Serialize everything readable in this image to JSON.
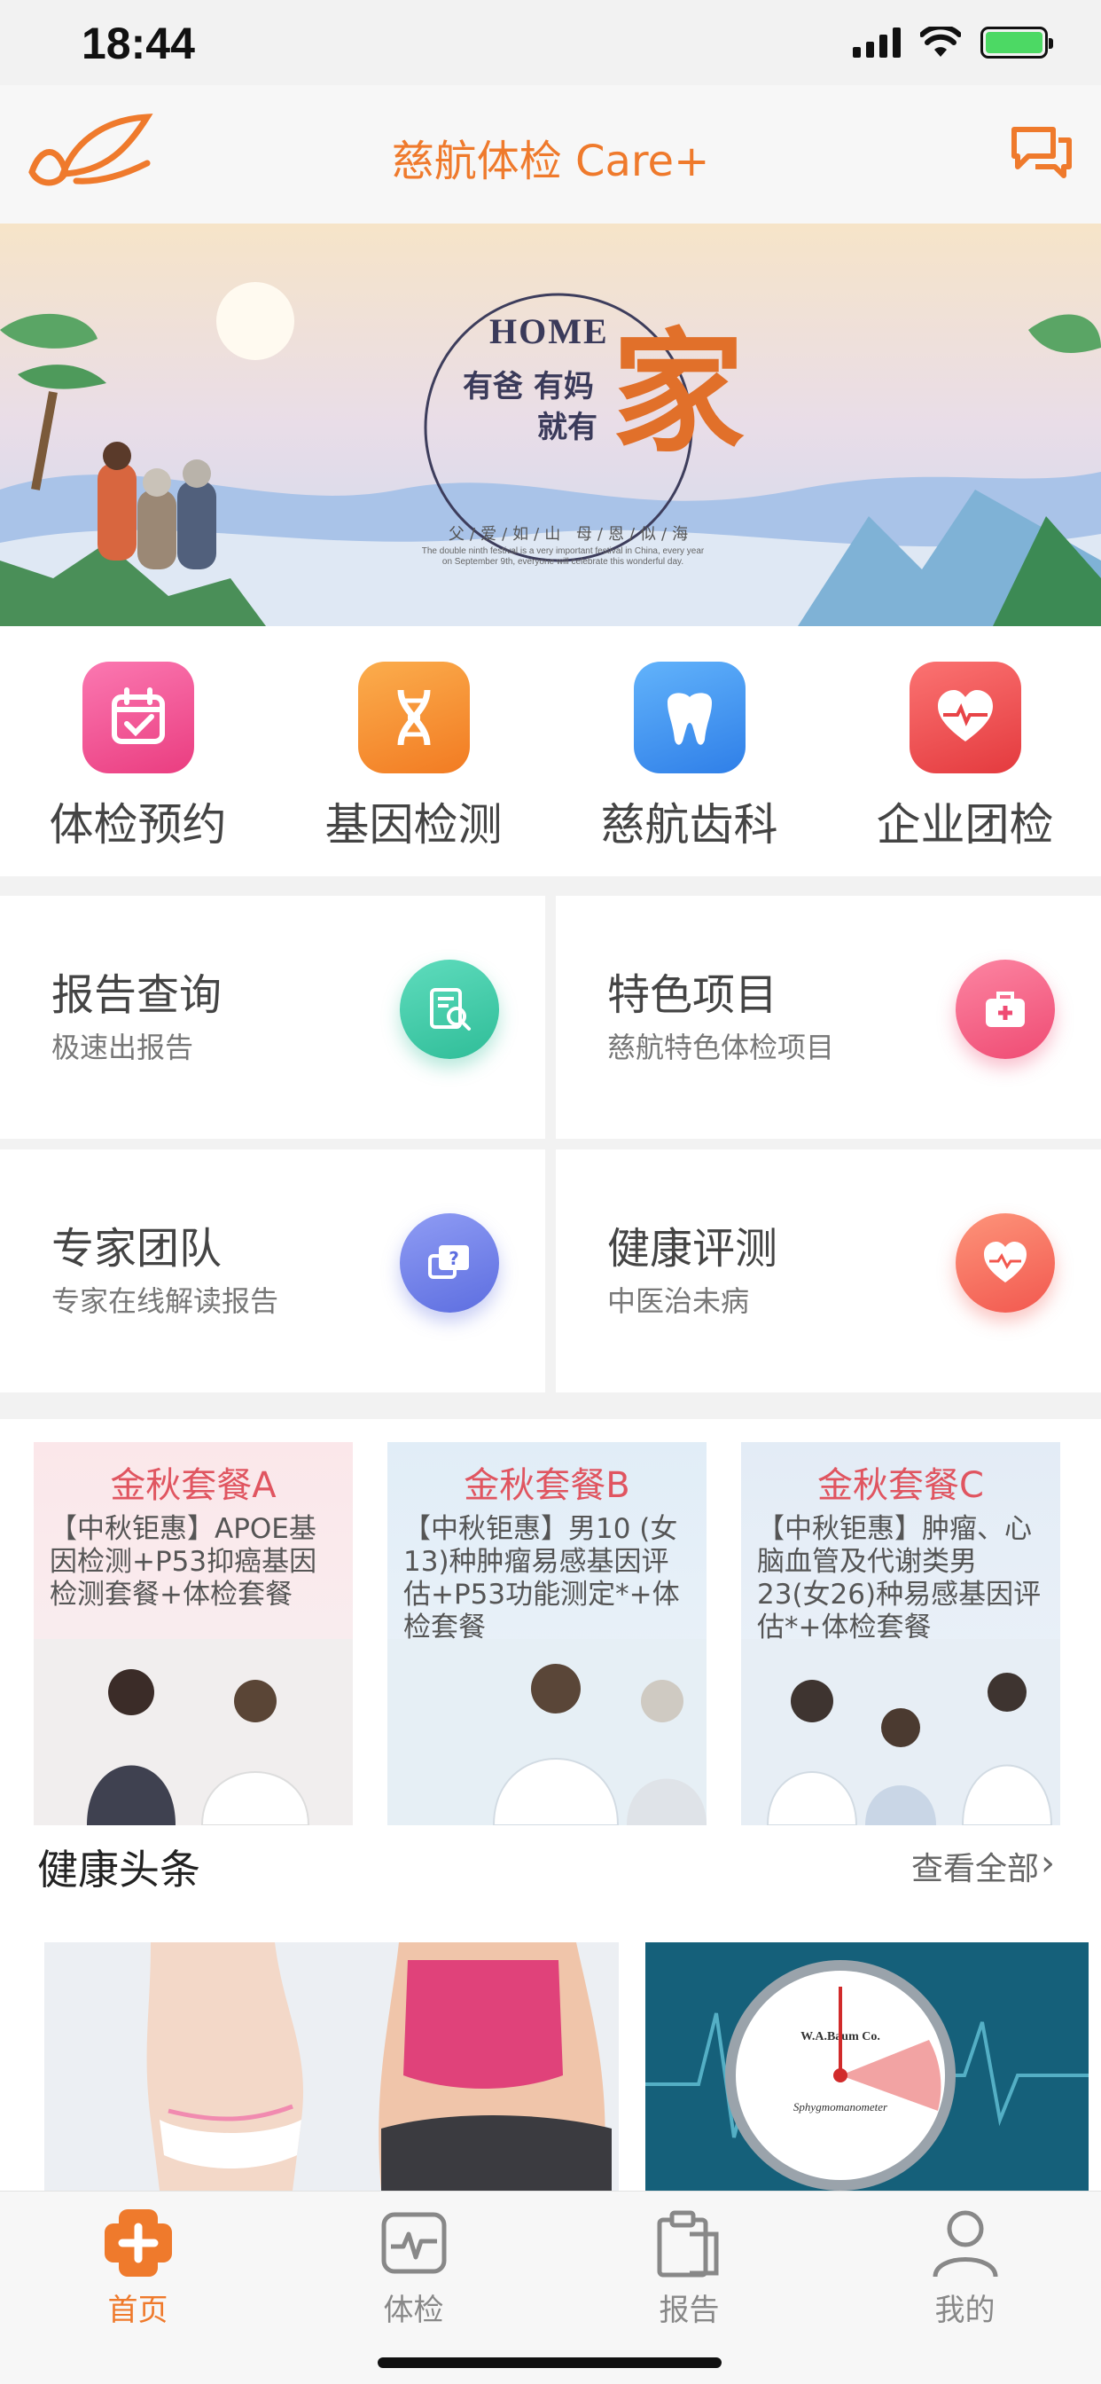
{
  "status_bar": {
    "time": "18:44"
  },
  "nav": {
    "title": "慈航体检 Care+"
  },
  "banner": {
    "home_text": "HOME",
    "line1": "有爸 有妈",
    "line2": "就有",
    "big_char": "家",
    "motto": "父/爱/如/山  母/恩/似/海",
    "desc": "The double ninth festival is a very important festival in China, every year on September 9th, everyone will celebrate this wonderful day."
  },
  "quick_menu": [
    {
      "label": "体检预约",
      "icon": "calendar-icon",
      "color": "#f0508a"
    },
    {
      "label": "基因检测",
      "icon": "dna-icon",
      "color": "#f3892e"
    },
    {
      "label": "慈航齿科",
      "icon": "tooth-icon",
      "color": "#3f95f0"
    },
    {
      "label": "企业团检",
      "icon": "heart-pulse-icon",
      "color": "#ee4a48"
    }
  ],
  "services": [
    {
      "title": "报告查询",
      "subtitle": "极速出报告",
      "icon": "report-search-icon",
      "color": "#37c7a6"
    },
    {
      "title": "特色项目",
      "subtitle": "慈航特色体检项目",
      "icon": "medical-kit-icon",
      "color": "#f2567d"
    },
    {
      "title": "专家团队",
      "subtitle": "专家在线解读报告",
      "icon": "question-chat-icon",
      "color": "#6c7de8"
    },
    {
      "title": "健康评测",
      "subtitle": "中医治未病",
      "icon": "heart-check-icon",
      "color": "#f66b5a"
    }
  ],
  "packages": [
    {
      "title": "金秋套餐A",
      "desc": "【中秋钜惠】APOE基因检测+P53抑癌基因检测套餐+体检套餐"
    },
    {
      "title": "金秋套餐B",
      "desc": "【中秋钜惠】男10 (女13)种肿瘤易感基因评估+P53功能测定*+体检套餐"
    },
    {
      "title": "金秋套餐C",
      "desc": "【中秋钜惠】肿瘤、心脑血管及代谢类男23(女26)种易感基因评估*+体检套餐"
    }
  ],
  "news": {
    "title": "健康头条",
    "view_all": "查看全部"
  },
  "tab_bar": [
    {
      "label": "首页",
      "icon": "home-cross-icon",
      "active": true
    },
    {
      "label": "体检",
      "icon": "pulse-monitor-icon",
      "active": false
    },
    {
      "label": "报告",
      "icon": "clipboard-icon",
      "active": false
    },
    {
      "label": "我的",
      "icon": "user-icon",
      "active": false
    }
  ],
  "colors": {
    "accent": "#ef7a2c",
    "package_title": "#e05560"
  }
}
